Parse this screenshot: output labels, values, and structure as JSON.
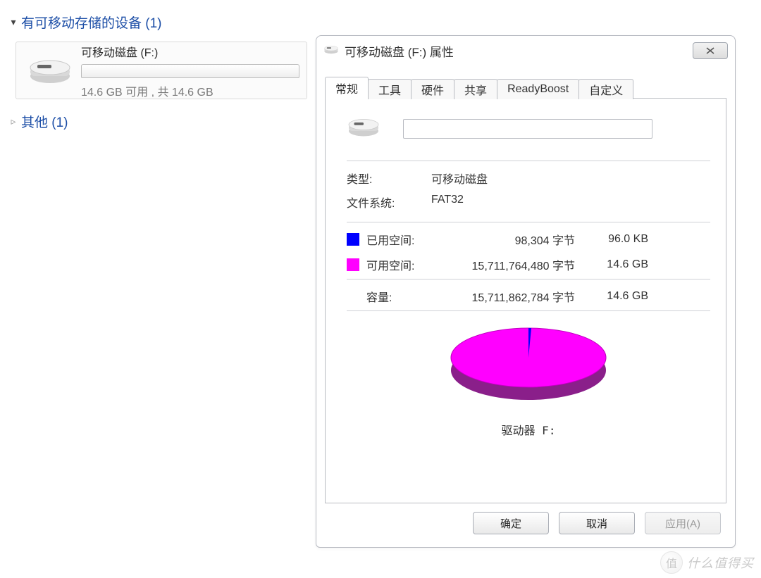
{
  "explorer": {
    "group_devices": {
      "label": "有可移动存储的设备 (1)",
      "expanded": true
    },
    "group_other": {
      "label": "其他 (1)",
      "expanded": false
    },
    "drive": {
      "title": "可移动磁盘 (F:)",
      "subtitle": "14.6 GB 可用 , 共 14.6 GB"
    }
  },
  "dialog": {
    "title": "可移动磁盘 (F:) 属性",
    "tabs": {
      "general": "常规",
      "tools": "工具",
      "hardware": "硬件",
      "sharing": "共享",
      "readyboost": "ReadyBoost",
      "custom": "自定义"
    },
    "fields": {
      "type_label": "类型:",
      "type_value": "可移动磁盘",
      "fs_label": "文件系统:",
      "fs_value": "FAT32",
      "used_label": "已用空间:",
      "used_bytes": "98,304 字节",
      "used_human": "96.0 KB",
      "free_label": "可用空间:",
      "free_bytes": "15,711,764,480 字节",
      "free_human": "14.6 GB",
      "capacity_label": "容量:",
      "capacity_bytes": "15,711,862,784 字节",
      "capacity_human": "14.6 GB",
      "drive_label": "驱动器 F:"
    },
    "buttons": {
      "ok": "确定",
      "cancel": "取消",
      "apply": "应用(A)"
    },
    "colors": {
      "used": "#0000ff",
      "free": "#ff00ff"
    }
  },
  "watermark": {
    "glyph": "值",
    "text": "什么值得买"
  },
  "chart_data": {
    "type": "pie",
    "title": "驱动器 F: 容量",
    "series": [
      {
        "name": "已用空间",
        "value_bytes": 98304,
        "value_human": "96.0 KB",
        "color": "#0000ff"
      },
      {
        "name": "可用空间",
        "value_bytes": 15711764480,
        "value_human": "14.6 GB",
        "color": "#ff00ff"
      }
    ],
    "total": {
      "name": "容量",
      "value_bytes": 15711862784,
      "value_human": "14.6 GB"
    }
  }
}
